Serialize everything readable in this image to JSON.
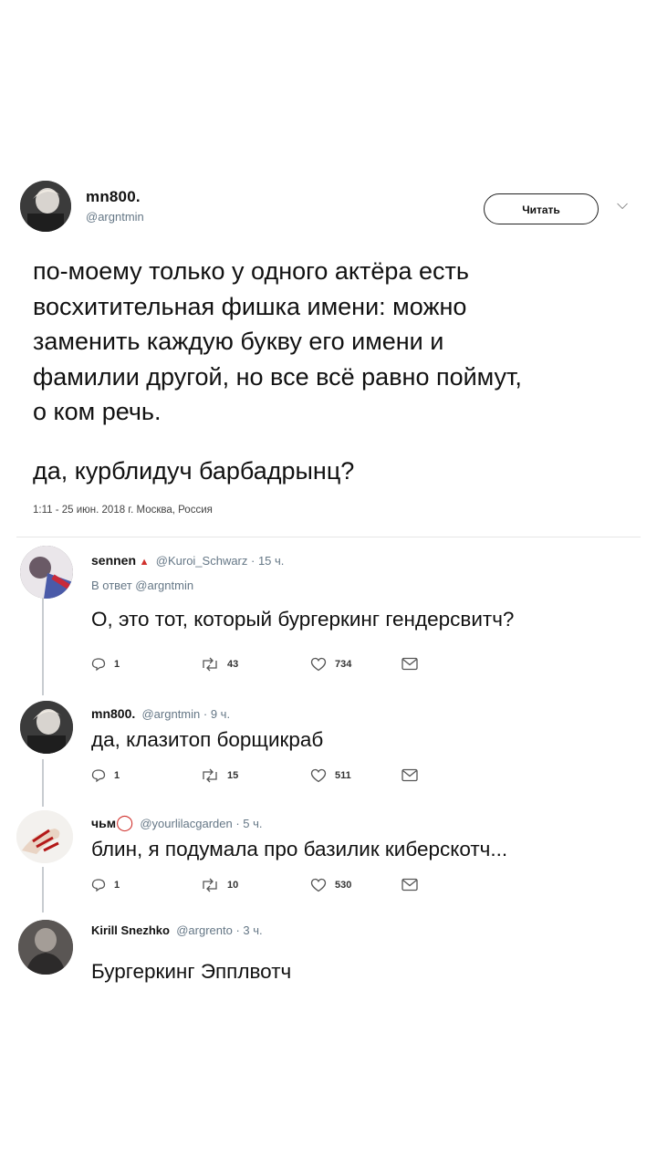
{
  "tweet": {
    "name": "mn800.",
    "handle": "@argntmin",
    "follow_label": "Читать",
    "text_lines": [
      "по-моему только у одного актёра есть",
      "восхитительная фишка имени: можно",
      "заменить каждую букву его имени и",
      "фамилии другой, но все всё равно поймут,",
      "о ком речь."
    ],
    "text2": "да, курблидуч барбадрынц?",
    "meta": "1:11 - 25 июн. 2018 г. Москва, Россия"
  },
  "replies": [
    {
      "name": "sennen",
      "badge": "▲",
      "handle": "@Kuroi_Schwarz",
      "time": "· 15 ч.",
      "reply_to": "В ответ @argntmin",
      "text": "О, это тот, который бургеркинг гендерсвитч?",
      "counts": {
        "reply": "1",
        "retweet": "43",
        "like": "734"
      }
    },
    {
      "name": "mn800.",
      "badge": "",
      "handle": "@argntmin",
      "time": "· 9 ч.",
      "reply_to": "",
      "text": "да, клазитоп борщикраб",
      "counts": {
        "reply": "1",
        "retweet": "15",
        "like": "511"
      }
    },
    {
      "name": "чьм",
      "badge": "◯",
      "handle": "@yourlilacgarden",
      "time": "· 5 ч.",
      "reply_to": "",
      "text": "блин, я подумала про базилик киберскотч...",
      "counts": {
        "reply": "1",
        "retweet": "10",
        "like": "530"
      }
    },
    {
      "name": "Kirill Snezhko",
      "badge": "",
      "handle": "@argrento",
      "time": "· 3 ч.",
      "reply_to": "",
      "text": "Бургеркинг Эпплвотч"
    }
  ],
  "icons": {
    "reply": "reply-icon",
    "retweet": "retweet-icon",
    "like": "heart-icon",
    "dm": "envelope-icon",
    "chevron": "chevron-down-icon"
  },
  "colors": {
    "muted": "#657786",
    "text": "#141414",
    "badge_red": "#d0312d"
  }
}
